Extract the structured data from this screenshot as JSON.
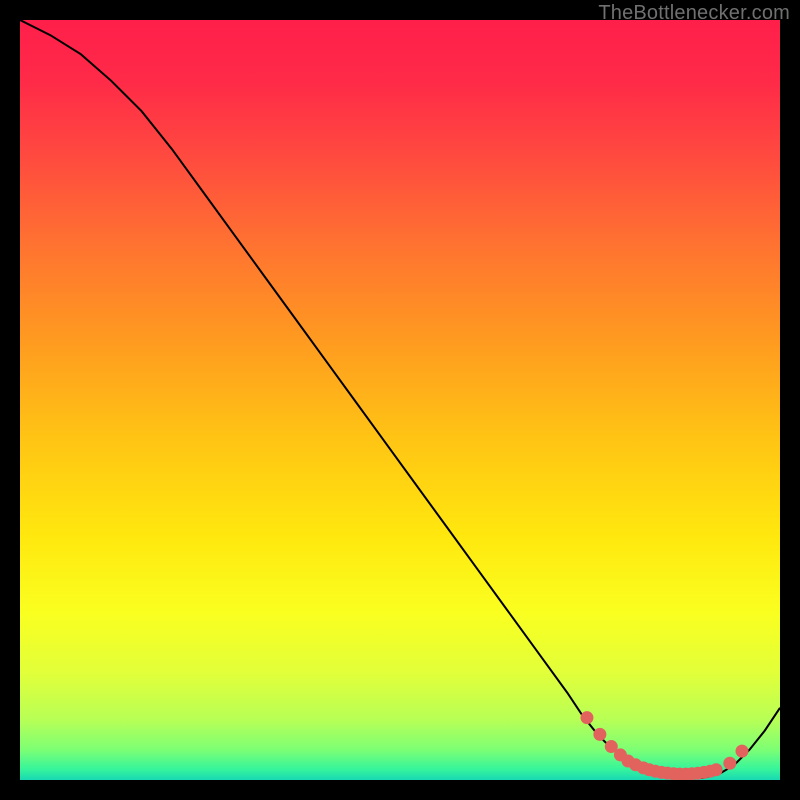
{
  "attribution": "TheBottlenecker.com",
  "chart_data": {
    "type": "line",
    "title": "",
    "xlabel": "",
    "ylabel": "",
    "xlim": [
      0,
      100
    ],
    "ylim": [
      0,
      100
    ],
    "series": [
      {
        "name": "curve",
        "x": [
          0,
          4,
          8,
          12,
          16,
          20,
          24,
          28,
          32,
          36,
          40,
          44,
          48,
          52,
          56,
          60,
          64,
          68,
          72,
          74,
          76,
          78,
          80,
          82,
          84,
          86,
          88,
          90,
          92,
          94,
          96,
          98,
          100
        ],
        "y": [
          100,
          98,
          95.5,
          92,
          88,
          83,
          77.5,
          72,
          66.5,
          61,
          55.5,
          50,
          44.5,
          39,
          33.5,
          28,
          22.5,
          17,
          11.5,
          8.5,
          6.0,
          4.0,
          2.5,
          1.5,
          0.8,
          0.4,
          0.2,
          0.3,
          0.8,
          2.0,
          4.0,
          6.5,
          9.5
        ]
      }
    ],
    "markers": {
      "name": "dots",
      "x": [
        74.6,
        76.3,
        77.8,
        79.0,
        80.0,
        81.0,
        82.0,
        82.8,
        83.6,
        84.4,
        85.2,
        86.0,
        86.8,
        87.6,
        88.4,
        89.2,
        90.0,
        90.8,
        91.6,
        93.4,
        95.0
      ],
      "y": [
        8.2,
        6.0,
        4.4,
        3.3,
        2.5,
        2.0,
        1.6,
        1.35,
        1.15,
        1.0,
        0.9,
        0.82,
        0.78,
        0.78,
        0.82,
        0.88,
        1.0,
        1.15,
        1.35,
        2.2,
        3.8
      ]
    },
    "gradient_stops": [
      {
        "offset": 0.0,
        "color": "#ff1f4a"
      },
      {
        "offset": 0.08,
        "color": "#ff2a48"
      },
      {
        "offset": 0.18,
        "color": "#ff4a3f"
      },
      {
        "offset": 0.3,
        "color": "#ff7430"
      },
      {
        "offset": 0.42,
        "color": "#ff9a20"
      },
      {
        "offset": 0.55,
        "color": "#ffc414"
      },
      {
        "offset": 0.68,
        "color": "#ffe80e"
      },
      {
        "offset": 0.78,
        "color": "#faff20"
      },
      {
        "offset": 0.86,
        "color": "#e1ff3a"
      },
      {
        "offset": 0.92,
        "color": "#b8ff55"
      },
      {
        "offset": 0.96,
        "color": "#7dff74"
      },
      {
        "offset": 0.985,
        "color": "#38f59a"
      },
      {
        "offset": 1.0,
        "color": "#18d8b4"
      }
    ],
    "marker_color": "#e2635e",
    "curve_color": "#000000"
  }
}
